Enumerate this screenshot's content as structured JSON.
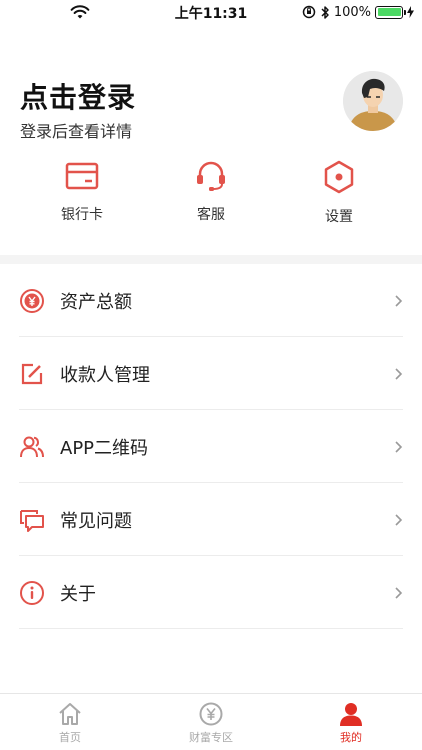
{
  "status_bar": {
    "time": "上午11:31",
    "battery": "100%",
    "battery_level": 1.0
  },
  "profile": {
    "title": "点击登录",
    "subtitle": "登录后查看详情"
  },
  "quick_actions": [
    {
      "label": "银行卡",
      "icon": "bank-card-icon"
    },
    {
      "label": "客服",
      "icon": "headset-icon"
    },
    {
      "label": "设置",
      "icon": "settings-hexagon-icon"
    }
  ],
  "menu": [
    {
      "label": "资产总额",
      "icon": "yen-circle-icon"
    },
    {
      "label": "收款人管理",
      "icon": "edit-square-icon"
    },
    {
      "label": "APP二维码",
      "icon": "users-icon"
    },
    {
      "label": "常见问题",
      "icon": "chat-bubbles-icon"
    },
    {
      "label": "关于",
      "icon": "info-circle-icon"
    }
  ],
  "tabbar": [
    {
      "label": "首页",
      "icon": "home-icon",
      "active": false
    },
    {
      "label": "财富专区",
      "icon": "yen-coin-icon",
      "active": false
    },
    {
      "label": "我的",
      "icon": "person-icon",
      "active": true
    }
  ],
  "colors": {
    "accent": "#e02e24",
    "icon_red": "#e2534b",
    "inactive": "#a9a9a9"
  }
}
